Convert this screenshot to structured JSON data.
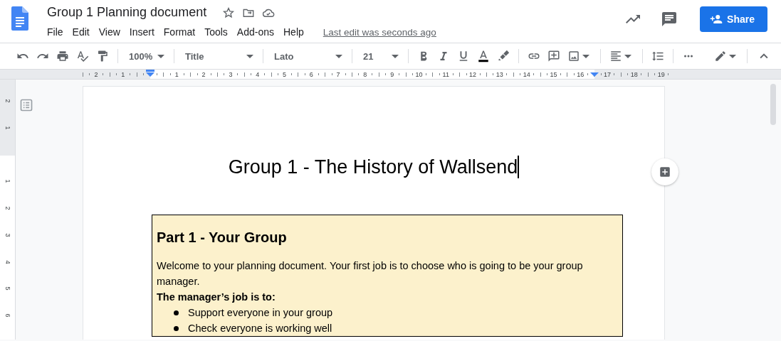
{
  "header": {
    "title": "Group 1 Planning document",
    "menu": [
      "File",
      "Edit",
      "View",
      "Insert",
      "Format",
      "Tools",
      "Add-ons",
      "Help"
    ],
    "last_edit": "Last edit was seconds ago",
    "share": "Share"
  },
  "toolbar": {
    "zoom": "100%",
    "style": "Title",
    "font": "Lato",
    "size": "21"
  },
  "ruler": {
    "horizontal_labels": [
      "2",
      "1",
      "1",
      "2",
      "3",
      "4",
      "5",
      "6",
      "7",
      "8",
      "9",
      "10",
      "11",
      "12",
      "13",
      "14",
      "15",
      "16",
      "17",
      "18",
      "19"
    ],
    "vertical_labels": [
      "2",
      "1",
      "1",
      "2",
      "3",
      "4",
      "5",
      "6"
    ]
  },
  "document": {
    "title": "Group 1 - The History of Wallsend",
    "box": {
      "heading": "Part 1 - Your Group",
      "paragraph": "Welcome to your planning document. Your first job is to choose who is going to be your group manager.",
      "subheading": "The manager’s job is to:",
      "bullets": [
        "Support everyone in your group",
        "Check everyone is working well"
      ]
    }
  }
}
